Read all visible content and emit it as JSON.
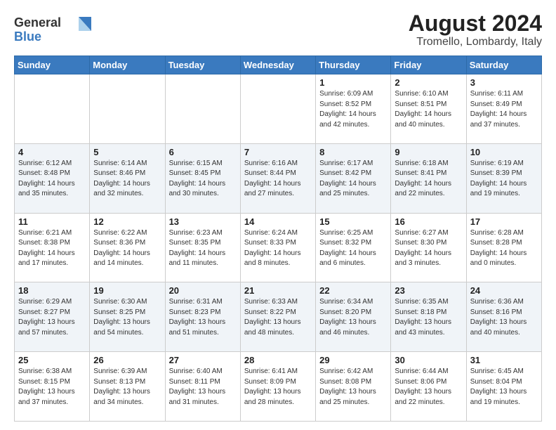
{
  "header": {
    "logo_line1": "General",
    "logo_line2": "Blue",
    "title": "August 2024",
    "subtitle": "Tromello, Lombardy, Italy"
  },
  "weekdays": [
    "Sunday",
    "Monday",
    "Tuesday",
    "Wednesday",
    "Thursday",
    "Friday",
    "Saturday"
  ],
  "weeks": [
    [
      {
        "day": "",
        "info": ""
      },
      {
        "day": "",
        "info": ""
      },
      {
        "day": "",
        "info": ""
      },
      {
        "day": "",
        "info": ""
      },
      {
        "day": "1",
        "info": "Sunrise: 6:09 AM\nSunset: 8:52 PM\nDaylight: 14 hours\nand 42 minutes."
      },
      {
        "day": "2",
        "info": "Sunrise: 6:10 AM\nSunset: 8:51 PM\nDaylight: 14 hours\nand 40 minutes."
      },
      {
        "day": "3",
        "info": "Sunrise: 6:11 AM\nSunset: 8:49 PM\nDaylight: 14 hours\nand 37 minutes."
      }
    ],
    [
      {
        "day": "4",
        "info": "Sunrise: 6:12 AM\nSunset: 8:48 PM\nDaylight: 14 hours\nand 35 minutes."
      },
      {
        "day": "5",
        "info": "Sunrise: 6:14 AM\nSunset: 8:46 PM\nDaylight: 14 hours\nand 32 minutes."
      },
      {
        "day": "6",
        "info": "Sunrise: 6:15 AM\nSunset: 8:45 PM\nDaylight: 14 hours\nand 30 minutes."
      },
      {
        "day": "7",
        "info": "Sunrise: 6:16 AM\nSunset: 8:44 PM\nDaylight: 14 hours\nand 27 minutes."
      },
      {
        "day": "8",
        "info": "Sunrise: 6:17 AM\nSunset: 8:42 PM\nDaylight: 14 hours\nand 25 minutes."
      },
      {
        "day": "9",
        "info": "Sunrise: 6:18 AM\nSunset: 8:41 PM\nDaylight: 14 hours\nand 22 minutes."
      },
      {
        "day": "10",
        "info": "Sunrise: 6:19 AM\nSunset: 8:39 PM\nDaylight: 14 hours\nand 19 minutes."
      }
    ],
    [
      {
        "day": "11",
        "info": "Sunrise: 6:21 AM\nSunset: 8:38 PM\nDaylight: 14 hours\nand 17 minutes."
      },
      {
        "day": "12",
        "info": "Sunrise: 6:22 AM\nSunset: 8:36 PM\nDaylight: 14 hours\nand 14 minutes."
      },
      {
        "day": "13",
        "info": "Sunrise: 6:23 AM\nSunset: 8:35 PM\nDaylight: 14 hours\nand 11 minutes."
      },
      {
        "day": "14",
        "info": "Sunrise: 6:24 AM\nSunset: 8:33 PM\nDaylight: 14 hours\nand 8 minutes."
      },
      {
        "day": "15",
        "info": "Sunrise: 6:25 AM\nSunset: 8:32 PM\nDaylight: 14 hours\nand 6 minutes."
      },
      {
        "day": "16",
        "info": "Sunrise: 6:27 AM\nSunset: 8:30 PM\nDaylight: 14 hours\nand 3 minutes."
      },
      {
        "day": "17",
        "info": "Sunrise: 6:28 AM\nSunset: 8:28 PM\nDaylight: 14 hours\nand 0 minutes."
      }
    ],
    [
      {
        "day": "18",
        "info": "Sunrise: 6:29 AM\nSunset: 8:27 PM\nDaylight: 13 hours\nand 57 minutes."
      },
      {
        "day": "19",
        "info": "Sunrise: 6:30 AM\nSunset: 8:25 PM\nDaylight: 13 hours\nand 54 minutes."
      },
      {
        "day": "20",
        "info": "Sunrise: 6:31 AM\nSunset: 8:23 PM\nDaylight: 13 hours\nand 51 minutes."
      },
      {
        "day": "21",
        "info": "Sunrise: 6:33 AM\nSunset: 8:22 PM\nDaylight: 13 hours\nand 48 minutes."
      },
      {
        "day": "22",
        "info": "Sunrise: 6:34 AM\nSunset: 8:20 PM\nDaylight: 13 hours\nand 46 minutes."
      },
      {
        "day": "23",
        "info": "Sunrise: 6:35 AM\nSunset: 8:18 PM\nDaylight: 13 hours\nand 43 minutes."
      },
      {
        "day": "24",
        "info": "Sunrise: 6:36 AM\nSunset: 8:16 PM\nDaylight: 13 hours\nand 40 minutes."
      }
    ],
    [
      {
        "day": "25",
        "info": "Sunrise: 6:38 AM\nSunset: 8:15 PM\nDaylight: 13 hours\nand 37 minutes."
      },
      {
        "day": "26",
        "info": "Sunrise: 6:39 AM\nSunset: 8:13 PM\nDaylight: 13 hours\nand 34 minutes."
      },
      {
        "day": "27",
        "info": "Sunrise: 6:40 AM\nSunset: 8:11 PM\nDaylight: 13 hours\nand 31 minutes."
      },
      {
        "day": "28",
        "info": "Sunrise: 6:41 AM\nSunset: 8:09 PM\nDaylight: 13 hours\nand 28 minutes."
      },
      {
        "day": "29",
        "info": "Sunrise: 6:42 AM\nSunset: 8:08 PM\nDaylight: 13 hours\nand 25 minutes."
      },
      {
        "day": "30",
        "info": "Sunrise: 6:44 AM\nSunset: 8:06 PM\nDaylight: 13 hours\nand 22 minutes."
      },
      {
        "day": "31",
        "info": "Sunrise: 6:45 AM\nSunset: 8:04 PM\nDaylight: 13 hours\nand 19 minutes."
      }
    ]
  ]
}
